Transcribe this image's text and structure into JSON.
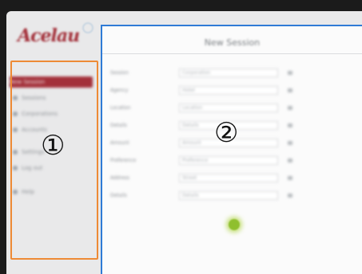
{
  "app": {
    "logo_text": "Acelau",
    "sidebar": {
      "items": [
        {
          "label": "New Session",
          "active": true
        },
        {
          "label": "Sessions",
          "active": false
        },
        {
          "label": "Corporations",
          "active": false
        },
        {
          "label": "Accounts",
          "active": false
        },
        {
          "label": "Settings",
          "active": false
        },
        {
          "label": "Log out",
          "active": false
        },
        {
          "label": "Help",
          "active": false
        }
      ]
    },
    "panel": {
      "title": "New Session",
      "rows": [
        {
          "label": "Session",
          "value": "Corporation"
        },
        {
          "label": "Agency",
          "value": "Hotel"
        },
        {
          "label": "Location",
          "value": "Location"
        },
        {
          "label": "Details",
          "value": "Details"
        },
        {
          "label": "Amount",
          "value": "Amount"
        },
        {
          "label": "Preference",
          "value": "Preference"
        },
        {
          "label": "Address",
          "value": "Street"
        },
        {
          "label": "Details",
          "value": "Details"
        }
      ]
    }
  },
  "annotations": {
    "marker_1": "①",
    "marker_2": "②",
    "box_color": "#ee8a35"
  },
  "colors": {
    "accent": "#a3303a",
    "panel_border": "#2f7bd6",
    "submit": "#8fbf2e"
  }
}
